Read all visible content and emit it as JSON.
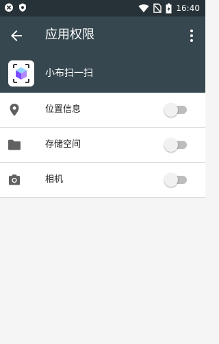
{
  "status_bar": {
    "time": "16:40",
    "left_icons": [
      "close-circle-icon",
      "shield-icon"
    ],
    "right_icons": [
      "wifi-icon",
      "no-sim-icon",
      "battery-charging-icon"
    ]
  },
  "app_bar": {
    "title": "应用权限",
    "back_icon": "arrow-back-icon",
    "overflow_icon": "more-vert-icon"
  },
  "app": {
    "name": "小布扫一扫",
    "icon": "cube-scan-icon"
  },
  "permissions": [
    {
      "label": "位置信息",
      "icon": "location-pin-icon",
      "enabled": false
    },
    {
      "label": "存储空间",
      "icon": "folder-icon",
      "enabled": false
    },
    {
      "label": "相机",
      "icon": "camera-icon",
      "enabled": false
    }
  ],
  "colors": {
    "app_bar": "#37474f",
    "status_bar": "#263238",
    "background": "#f5f5f5",
    "toggle_off_track": "#bdbdbd",
    "toggle_off_thumb": "#f1f1f1"
  }
}
